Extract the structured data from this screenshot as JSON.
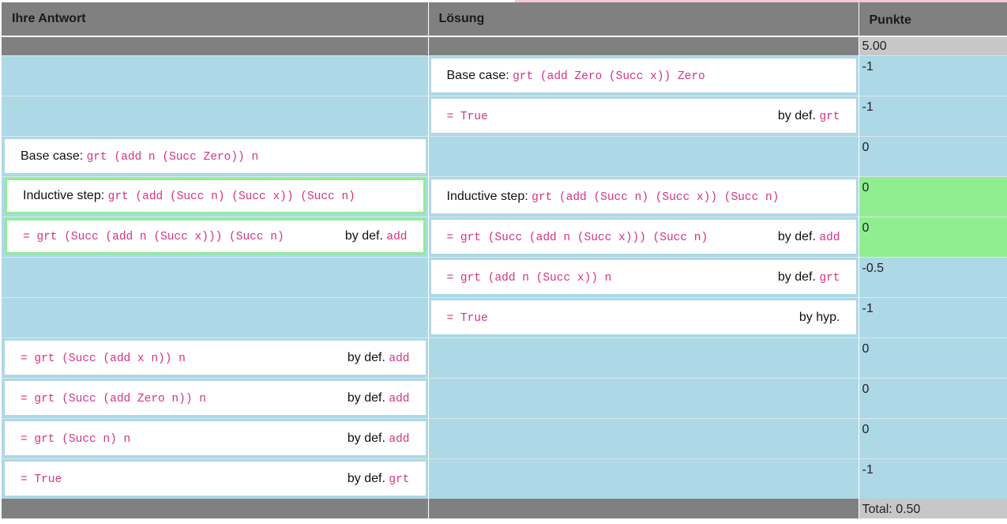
{
  "header": {
    "col_answer": "Ihre Antwort",
    "col_solution": "Lösung",
    "col_points": "Punkte"
  },
  "max_points": "5.00",
  "rows": [
    {
      "answer": null,
      "solution": {
        "prefix": "Base case: ",
        "code": "grt (add Zero (Succ x)) Zero",
        "just_text": "",
        "just_code": ""
      },
      "points": "-1",
      "match": false
    },
    {
      "answer": null,
      "solution": {
        "prefix": "",
        "code": "= True",
        "just_text": "by def. ",
        "just_code": "grt"
      },
      "points": "-1",
      "match": false
    },
    {
      "answer": {
        "prefix": "Base case: ",
        "code": "grt (add n (Succ Zero)) n",
        "just_text": "",
        "just_code": ""
      },
      "solution": null,
      "points": "0",
      "match": false
    },
    {
      "answer": {
        "prefix": "Inductive step: ",
        "code": "grt (add (Succ n) (Succ x)) (Succ n)",
        "just_text": "",
        "just_code": ""
      },
      "solution": {
        "prefix": "Inductive step: ",
        "code": "grt (add (Succ n) (Succ x)) (Succ n)",
        "just_text": "",
        "just_code": ""
      },
      "points": "0",
      "match": true
    },
    {
      "answer": {
        "prefix": "",
        "code": "= grt (Succ (add n (Succ x))) (Succ n)",
        "just_text": "by def. ",
        "just_code": "add"
      },
      "solution": {
        "prefix": "",
        "code": "= grt (Succ (add n (Succ x))) (Succ n)",
        "just_text": "by def. ",
        "just_code": "add"
      },
      "points": "0",
      "match": true
    },
    {
      "answer": null,
      "solution": {
        "prefix": "",
        "code": "= grt (add n (Succ x)) n",
        "just_text": "by def. ",
        "just_code": "grt"
      },
      "points": "-0.5",
      "match": false
    },
    {
      "answer": null,
      "solution": {
        "prefix": "",
        "code": "= True",
        "just_text": "by hyp.",
        "just_code": ""
      },
      "points": "-1",
      "match": false
    },
    {
      "answer": {
        "prefix": "",
        "code": "= grt (Succ (add x n)) n",
        "just_text": "by def. ",
        "just_code": "add"
      },
      "solution": null,
      "points": "0",
      "match": false
    },
    {
      "answer": {
        "prefix": "",
        "code": "= grt (Succ (add Zero n)) n",
        "just_text": "by def. ",
        "just_code": "add"
      },
      "solution": null,
      "points": "0",
      "match": false
    },
    {
      "answer": {
        "prefix": "",
        "code": "= grt (Succ n) n",
        "just_text": "by def. ",
        "just_code": "add"
      },
      "solution": null,
      "points": "0",
      "match": false
    },
    {
      "answer": {
        "prefix": "",
        "code": "= True",
        "just_text": "by def. ",
        "just_code": "grt"
      },
      "solution": null,
      "points": "-1",
      "match": false
    }
  ],
  "total": "Total: 0.50"
}
